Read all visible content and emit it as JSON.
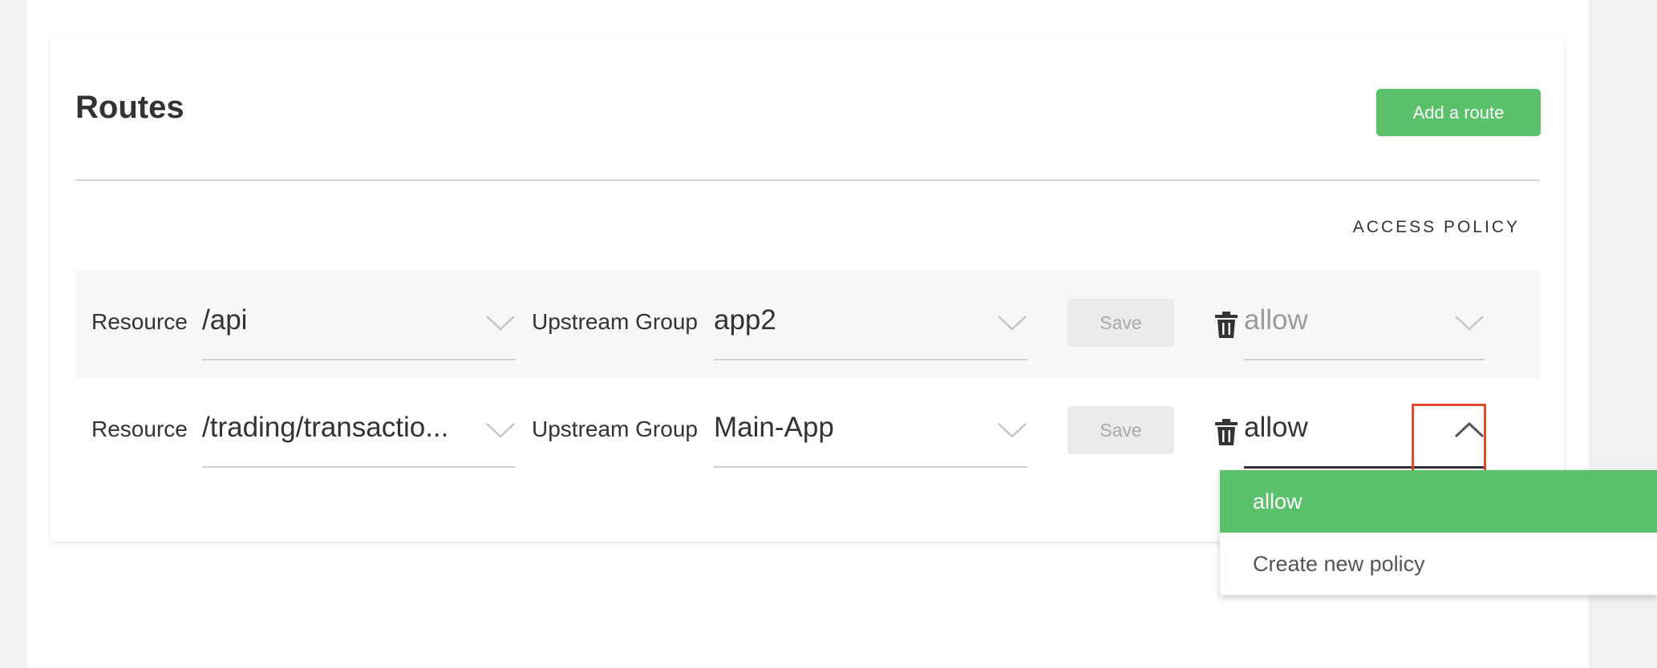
{
  "routes": {
    "title": "Routes",
    "add_button": "Add a route",
    "access_policy_header": "ACCESS POLICY",
    "rows": [
      {
        "resource_label": "Resource",
        "resource_value": "/api",
        "upstream_label": "Upstream Group",
        "upstream_value": "app2",
        "save_label": "Save",
        "policy_value": "allow"
      },
      {
        "resource_label": "Resource",
        "resource_value": "/trading/transactio...",
        "upstream_label": "Upstream Group",
        "upstream_value": "Main-App",
        "save_label": "Save",
        "policy_value": "allow"
      }
    ]
  },
  "policy_dropdown": {
    "options": [
      "allow",
      "Create new policy"
    ],
    "selected": "allow"
  },
  "colors": {
    "accent_green": "#5ac06a",
    "highlight_red": "#e2492f"
  },
  "icons": [
    "chevron-down-icon",
    "chevron-up-icon",
    "trash-icon"
  ]
}
